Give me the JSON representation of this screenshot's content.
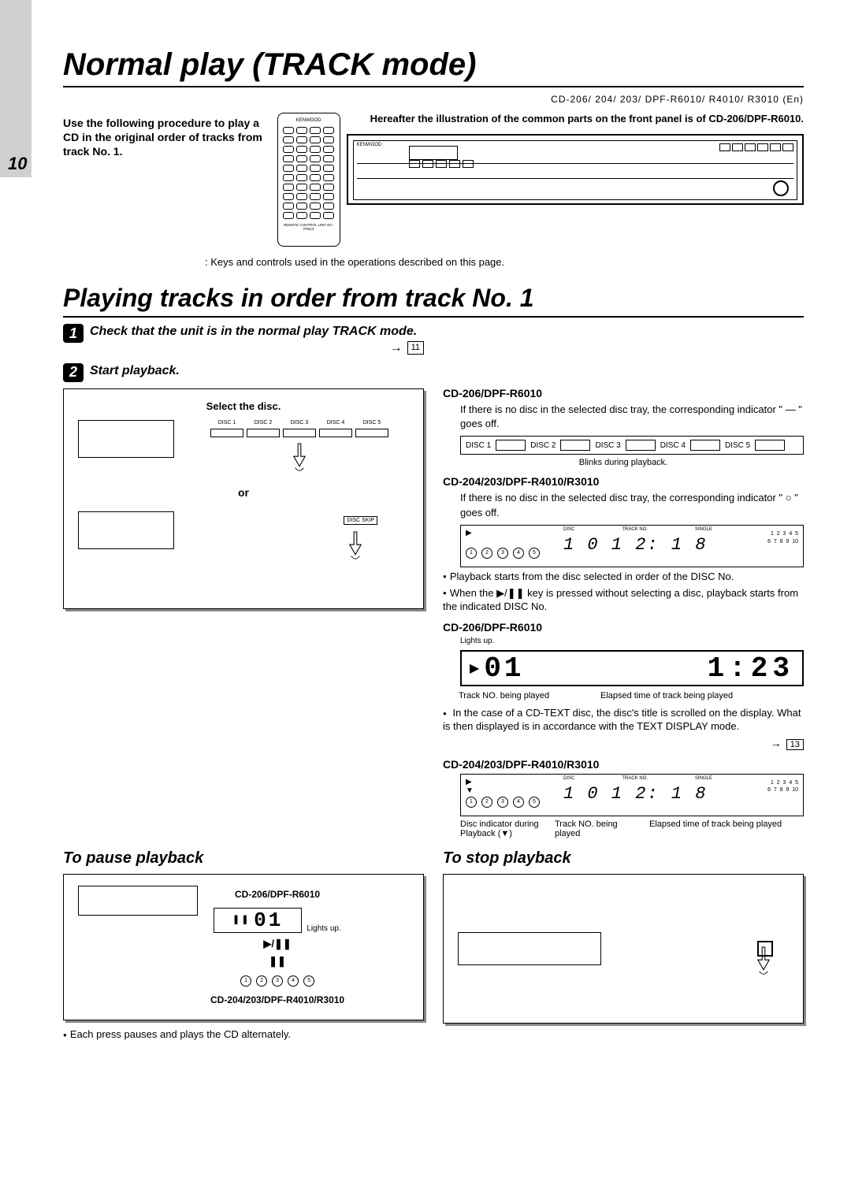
{
  "page_number": "10",
  "title": "Normal play (TRACK mode)",
  "models_header": "CD-206/ 204/ 203/ DPF-R6010/ R4010/ R3010 (En)",
  "intro": "Use the following procedure to play a CD in the original order of tracks from track No. 1.",
  "remote_brand": "KENWOOD",
  "remote_note": "REMOTE CONTROL UNIT RC-P0513",
  "panel_note": "Hereafter the illustration of the common parts on the front panel is of CD-206/DPF-R6010.",
  "caption": ": Keys and controls used in the operations described on this page.",
  "subtitle": "Playing tracks in order from track No. 1",
  "step1": {
    "text": "Check that the unit is in the normal play TRACK mode.",
    "ref": "11"
  },
  "step2": {
    "text": "Start playback."
  },
  "select_disc": "Select the disc.",
  "disc_labels": [
    "DISC 1",
    "DISC 2",
    "DISC 3",
    "DISC 4",
    "DISC 5"
  ],
  "or": "or",
  "disc_skip": "DISC SKIP",
  "right": {
    "m1": "CD-206/DPF-R6010",
    "m1_text": "If there is no disc in the selected disc tray, the corresponding indicator \" — \" goes off.",
    "blinks": "Blinks during playback.",
    "m2": "CD-204/203/DPF-R4010/R3010",
    "m2_text": "If there is no disc in the selected disc tray, the corresponding indicator \" ○ \" goes off.",
    "lcd2_nums": "1 0 1   2: 1 8",
    "grid_nums": "1  2  3  4  5\n6  7  8  9  10",
    "disc_label": "DISC",
    "track_label": "TRACK NO.",
    "single_label": "SINGLE",
    "b1": "Playback starts from the disc selected in order of the DISC No.",
    "b2": "When the ▶/❚❚ key is pressed without selecting a disc, playback starts from the indicated DISC No.",
    "m3": "CD-206/DPF-R6010",
    "lights_up": "Lights up.",
    "lcd_track": "01",
    "lcd_time": "1:23",
    "under1": "Track NO. being played",
    "under2": "Elapsed time of track being played",
    "b3": "In the case of a CD-TEXT disc, the disc's title is scrolled on the display. What is then displayed is in accordance with the TEXT DISPLAY mode.",
    "ref13": "13",
    "m4": "CD-204/203/DPF-R4010/R3010",
    "disc_ind": "Disc indicator during Playback (▼)",
    "under3": "Track NO. being played",
    "under4": "Elapsed time of track being played"
  },
  "pause": {
    "title": "To pause playback",
    "m1": "CD-206/DPF-R6010",
    "lights_up": "Lights up.",
    "lcd": "01",
    "pp": "▶/❚❚",
    "pause_sym": "❚❚",
    "m2": "CD-204/203/DPF-R4010/R3010",
    "note": "Each press pauses and plays the CD alternately."
  },
  "stop": {
    "title": "To stop playback"
  }
}
